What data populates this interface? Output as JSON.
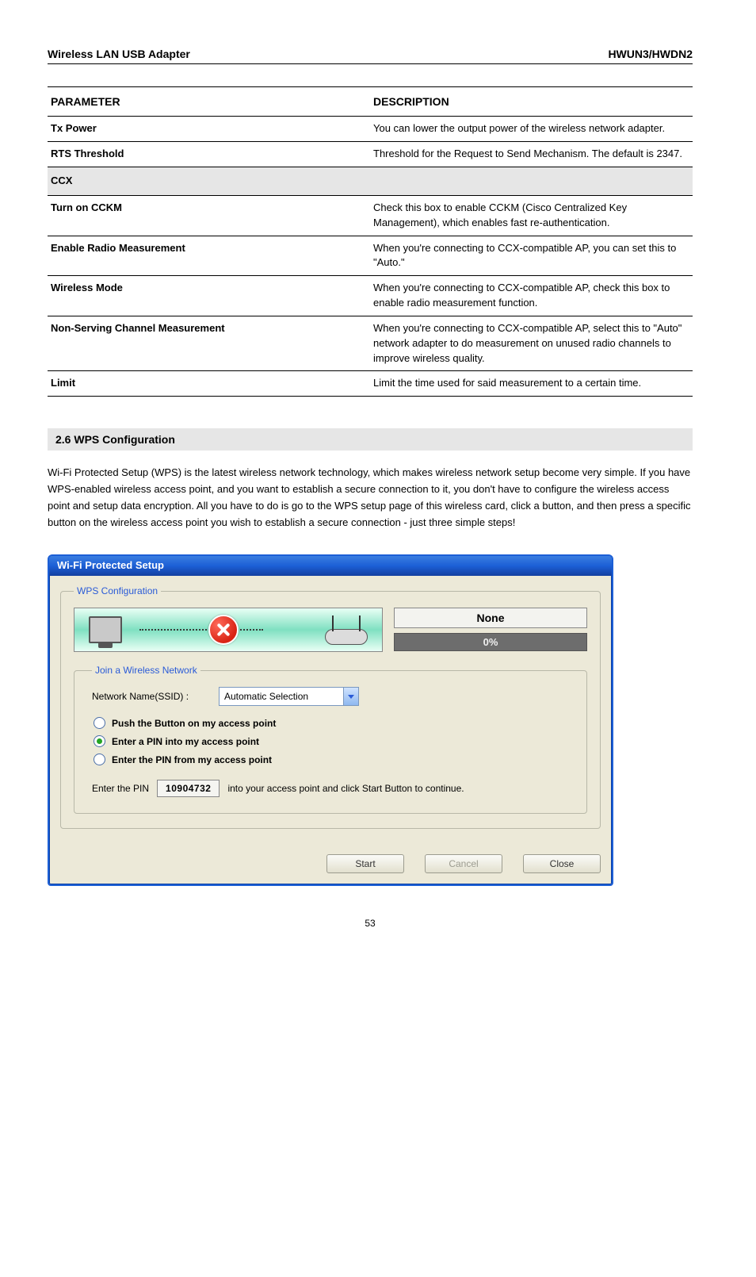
{
  "doc": {
    "product_left": "Wireless LAN USB Adapter",
    "product_right": "HWUN3/HWDN2",
    "page_number": "53"
  },
  "table": {
    "header": {
      "c1": "PARAMETER",
      "c2": "DESCRIPTION"
    },
    "rows": [
      {
        "c1": "Tx Power",
        "c2": "You can lower the output power of the wireless network adapter."
      },
      {
        "c1": "RTS Threshold",
        "c2": "Threshold for the Request to Send Mechanism. The default is 2347."
      }
    ],
    "section": "CCX",
    "rows2": [
      {
        "c1": "Turn on CCKM",
        "c2": "Check this box to enable CCKM (Cisco Centralized Key Management), which enables fast re-authentication."
      },
      {
        "c1": "Enable Radio Measurement",
        "c2": "When you're connecting to CCX-compatible AP, you can set this to \"Auto.\""
      },
      {
        "c1": "Wireless Mode",
        "c2": "When you're connecting to CCX-compatible AP, check this box to enable radio measurement function."
      },
      {
        "c1": "Non-Serving Channel Measurement",
        "c2": "When you're connecting to CCX-compatible AP, select this to \"Auto\" network adapter to do measurement on unused radio channels to improve wireless quality."
      },
      {
        "c1": "Limit",
        "c2": "Limit the time used for said measurement to a certain time."
      }
    ]
  },
  "section6": {
    "title": "2.6 WPS Configuration",
    "para": "Wi-Fi Protected Setup (WPS) is the latest wireless network technology, which makes wireless network setup become very simple. If you have WPS-enabled wireless access point, and you want to establish a secure connection to it, you don't have to configure the wireless access point and setup data encryption. All you have to do is go to the WPS setup page of this wireless card, click a button, and then press a specific button on the wireless access point you wish to establish a secure connection - just three simple steps!"
  },
  "dialog": {
    "title": "Wi-Fi Protected Setup",
    "fieldset_label": "WPS Configuration",
    "status_text": "None",
    "progress": "0%",
    "join_label": "Join a Wireless Network",
    "ssid_label": "Network Name(SSID) :",
    "ssid_value": "Automatic Selection",
    "radios": {
      "push": "Push the Button on my access point",
      "enter_into": "Enter a PIN into my access point",
      "enter_from": "Enter the PIN from my access point",
      "selected": "enter_into"
    },
    "pin_label": "Enter the PIN",
    "pin_value": "10904732",
    "pin_tail": "into your access point and click Start Button to continue.",
    "buttons": {
      "start": "Start",
      "cancel": "Cancel",
      "close": "Close"
    }
  }
}
